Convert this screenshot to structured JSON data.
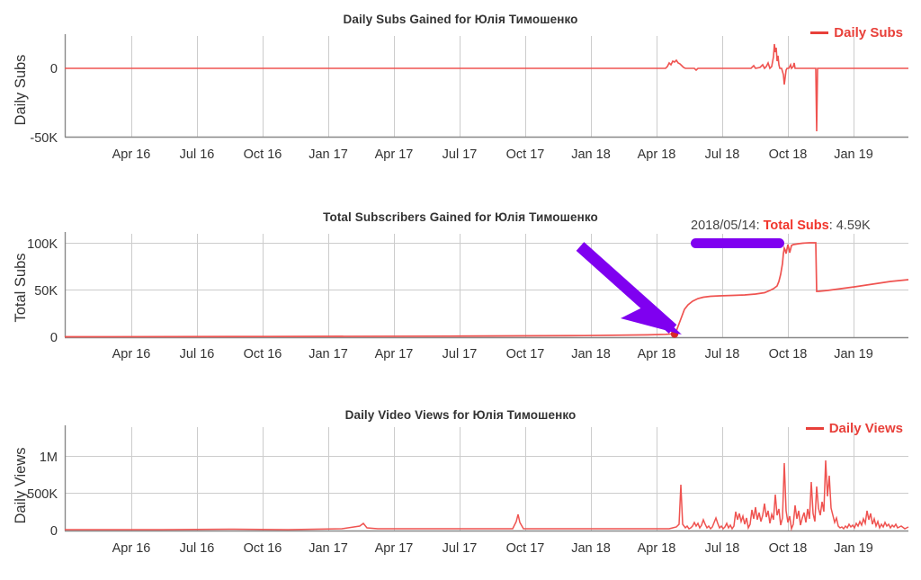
{
  "page": {
    "background": "#ffffff",
    "series_color": "#ef5350",
    "accent_red": "#e8403a",
    "annotation_purple": "#7f00f0",
    "axis_color": "#999999",
    "grid_color": "#cccccc",
    "text_color": "#333333"
  },
  "charts": [
    {
      "id": "chart1",
      "title": "Daily Subs Gained for Юлія Тимошенко",
      "ylabel": "Daily Subs",
      "legend": "Daily Subs",
      "yticks": [
        "0",
        "-50K"
      ],
      "xticks": [
        "Apr 16",
        "Jul 16",
        "Oct 16",
        "Jan 17",
        "Apr 17",
        "Jul 17",
        "Oct 17",
        "Jan 18",
        "Apr 18",
        "Jul 18",
        "Oct 18",
        "Jan 19"
      ]
    },
    {
      "id": "chart2",
      "title": "Total Subscribers Gained for Юлія Тимошенко",
      "ylabel": "Total Subs",
      "legend": "",
      "yticks": [
        "0",
        "50K",
        "100K"
      ],
      "xticks": [
        "Apr 16",
        "Jul 16",
        "Oct 16",
        "Jan 17",
        "Apr 17",
        "Jul 17",
        "Oct 17",
        "Jan 18",
        "Apr 18",
        "Jul 18",
        "Oct 18",
        "Jan 19"
      ],
      "tooltip": {
        "date": "2018/05/14:",
        "metric": "Total Subs",
        "value": ": 4.59K"
      }
    },
    {
      "id": "chart3",
      "title": "Daily Video Views for Юлія Тимошенко",
      "ylabel": "Daily Views",
      "legend": "Daily Views",
      "yticks": [
        "0",
        "500K",
        "1M"
      ],
      "xticks": [
        "Apr 16",
        "Jul 16",
        "Oct 16",
        "Jan 17",
        "Apr 17",
        "Jul 17",
        "Oct 17",
        "Jan 18",
        "Apr 18",
        "Jul 18",
        "Oct 18",
        "Jan 19"
      ]
    }
  ],
  "chart_data": [
    {
      "type": "line",
      "title": "Daily Subs Gained for Юлія Тимошенко",
      "xlabel": "",
      "ylabel": "Daily Subs",
      "legend": [
        "Daily Subs"
      ],
      "legend_position": "top-right",
      "grid": true,
      "xlim": [
        "2016-01-15",
        "2019-03-15"
      ],
      "ylim": [
        -50000,
        12000
      ],
      "yticks": [
        0,
        -50000
      ],
      "ytick_labels": [
        "0",
        "-50K"
      ],
      "xticks": [
        "Apr 16",
        "Jul 16",
        "Oct 16",
        "Jan 17",
        "Apr 17",
        "Jul 17",
        "Oct 17",
        "Jan 18",
        "Apr 18",
        "Jul 18",
        "Oct 18",
        "Jan 19"
      ],
      "series": [
        {
          "name": "Daily Subs",
          "color": "#ef5350",
          "x": [
            "2016-01-15",
            "2016-04-01",
            "2016-07-01",
            "2016-10-01",
            "2017-01-01",
            "2017-04-01",
            "2017-07-01",
            "2017-10-01",
            "2018-01-01",
            "2018-04-01",
            "2018-05-05",
            "2018-05-14",
            "2018-05-20",
            "2018-05-26",
            "2018-06-02",
            "2018-06-10",
            "2018-06-20",
            "2018-07-10",
            "2018-08-10",
            "2018-09-10",
            "2018-09-25",
            "2018-10-01",
            "2018-10-05",
            "2018-10-09",
            "2018-10-12",
            "2018-10-15",
            "2018-10-18",
            "2018-10-21",
            "2018-10-24",
            "2018-10-28",
            "2018-11-02",
            "2018-11-08",
            "2018-11-14",
            "2018-11-20",
            "2018-12-05",
            "2018-12-10",
            "2018-12-12",
            "2018-12-14",
            "2018-12-20",
            "2019-01-10",
            "2019-02-10",
            "2019-03-10"
          ],
          "y": [
            0,
            0,
            0,
            0,
            0,
            0,
            0,
            0,
            0,
            0,
            0,
            700,
            1600,
            2100,
            1500,
            900,
            300,
            120,
            120,
            150,
            1400,
            900,
            2600,
            1800,
            9800,
            5600,
            2200,
            1200,
            -7000,
            600,
            1600,
            900,
            200,
            150,
            0,
            0,
            -45500,
            0,
            0,
            120,
            160,
            120
          ]
        }
      ]
    },
    {
      "type": "line",
      "title": "Total Subscribers Gained for Юлія Тимошенко",
      "xlabel": "",
      "ylabel": "Total Subs",
      "legend": [],
      "grid": true,
      "xlim": [
        "2016-01-15",
        "2019-03-15"
      ],
      "ylim": [
        0,
        120000
      ],
      "yticks": [
        0,
        50000,
        100000
      ],
      "ytick_labels": [
        "0",
        "50K",
        "100K"
      ],
      "xticks": [
        "Apr 16",
        "Jul 16",
        "Oct 16",
        "Jan 17",
        "Apr 17",
        "Jul 17",
        "Oct 17",
        "Jan 18",
        "Apr 18",
        "Jul 18",
        "Oct 18",
        "Jan 19"
      ],
      "annotations": [
        {
          "type": "marker",
          "label": "2018/05/14: Total Subs: 4.59K",
          "x": "2018-05-14",
          "y": 4590,
          "color": "#d32f2f"
        },
        {
          "type": "arrow",
          "color": "#7f00f0",
          "from_x": "2017-12-20",
          "from_y": 103000,
          "to_x": "2018-05-14",
          "to_y": 4590
        },
        {
          "type": "underline-bar",
          "color": "#7f00f0"
        }
      ],
      "series": [
        {
          "name": "Total Subs",
          "color": "#ef5350",
          "x": [
            "2016-01-15",
            "2016-07-01",
            "2017-01-01",
            "2017-07-01",
            "2018-01-01",
            "2018-04-15",
            "2018-05-14",
            "2018-05-25",
            "2018-06-05",
            "2018-06-20",
            "2018-07-10",
            "2018-08-10",
            "2018-09-05",
            "2018-09-20",
            "2018-09-28",
            "2018-10-03",
            "2018-10-08",
            "2018-10-11",
            "2018-10-14",
            "2018-10-17",
            "2018-10-22",
            "2018-10-28",
            "2018-11-10",
            "2018-11-25",
            "2018-12-08",
            "2018-12-12",
            "2018-12-20",
            "2019-01-10",
            "2019-02-10",
            "2019-03-10"
          ],
          "y": [
            300,
            400,
            600,
            900,
            1800,
            3200,
            4590,
            22000,
            38000,
            42500,
            44000,
            45000,
            46500,
            50000,
            56000,
            60000,
            78000,
            104000,
            98000,
            108000,
            109000,
            110000,
            110500,
            111000,
            111000,
            55000,
            57000,
            60000,
            64000,
            67000
          ]
        }
      ]
    },
    {
      "type": "line",
      "title": "Daily Video Views for Юлія Тимошенко",
      "xlabel": "",
      "ylabel": "Daily Views",
      "legend": [
        "Daily Views"
      ],
      "legend_position": "top-right",
      "grid": true,
      "xlim": [
        "2016-01-15",
        "2019-03-15"
      ],
      "ylim": [
        0,
        1300000
      ],
      "yticks": [
        0,
        500000,
        1000000
      ],
      "ytick_labels": [
        "0",
        "500K",
        "1M"
      ],
      "xticks": [
        "Apr 16",
        "Jul 16",
        "Oct 16",
        "Jan 17",
        "Apr 17",
        "Jul 17",
        "Oct 17",
        "Jan 18",
        "Apr 18",
        "Jul 18",
        "Oct 18",
        "Jan 19"
      ],
      "series": [
        {
          "name": "Daily Views",
          "color": "#ef5350",
          "x": [
            "2016-01-15",
            "2016-06-01",
            "2016-12-01",
            "2017-03-01",
            "2017-04-10",
            "2017-05-20",
            "2017-09-20",
            "2017-10-05",
            "2017-10-20",
            "2018-01-10",
            "2018-04-01",
            "2018-05-05",
            "2018-05-14",
            "2018-05-18",
            "2018-05-24",
            "2018-06-02",
            "2018-06-12",
            "2018-06-22",
            "2018-07-02",
            "2018-07-12",
            "2018-07-22",
            "2018-08-02",
            "2018-08-12",
            "2018-08-22",
            "2018-09-01",
            "2018-09-08",
            "2018-09-16",
            "2018-09-24",
            "2018-10-01",
            "2018-10-06",
            "2018-10-11",
            "2018-10-16",
            "2018-10-21",
            "2018-10-26",
            "2018-11-01",
            "2018-11-08",
            "2018-11-15",
            "2018-11-22",
            "2018-12-01",
            "2018-12-08",
            "2018-12-14",
            "2018-12-20",
            "2018-12-28",
            "2019-01-05",
            "2019-01-12",
            "2019-01-20",
            "2019-01-28",
            "2019-02-05",
            "2019-02-12",
            "2019-02-20",
            "2019-03-01",
            "2019-03-10"
          ],
          "y": [
            5000,
            8000,
            12000,
            9000,
            55000,
            20000,
            14000,
            120000,
            30000,
            18000,
            22000,
            30000,
            60000,
            620000,
            90000,
            130000,
            200000,
            160000,
            120000,
            330000,
            210000,
            380000,
            250000,
            420000,
            300000,
            470000,
            230000,
            1010000,
            170000,
            350000,
            450000,
            200000,
            660000,
            300000,
            640000,
            760000,
            290000,
            1060000,
            980000,
            420000,
            150000,
            130000,
            180000,
            220000,
            410000,
            330000,
            280000,
            160000,
            140000,
            120000,
            210000,
            150000
          ]
        }
      ]
    }
  ]
}
